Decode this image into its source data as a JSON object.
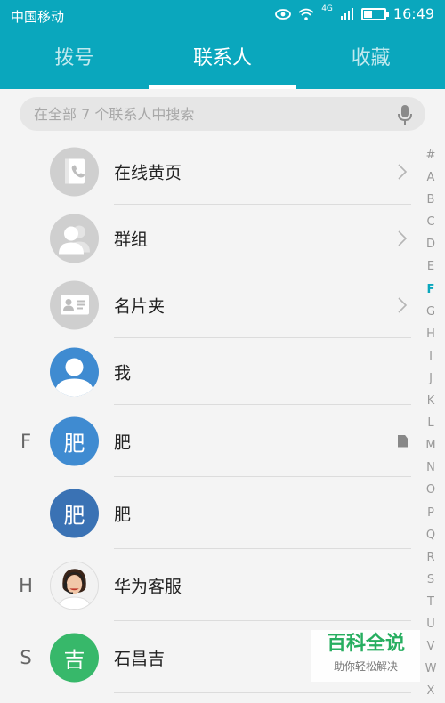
{
  "status": {
    "carrier": "中国移动",
    "net": "4G",
    "time": "16:49"
  },
  "tabs": [
    {
      "label": "拨号",
      "active": false
    },
    {
      "label": "联系人",
      "active": true
    },
    {
      "label": "收藏",
      "active": false
    }
  ],
  "search": {
    "placeholder": "在全部 7 个联系人中搜索"
  },
  "contacts": [
    {
      "letter": "",
      "name": "在线黄页",
      "avatar": "yellow-pages-icon",
      "chevron": true
    },
    {
      "letter": "",
      "name": "群组",
      "avatar": "group-icon",
      "chevron": true
    },
    {
      "letter": "",
      "name": "名片夹",
      "avatar": "business-card-icon",
      "chevron": true
    },
    {
      "letter": "",
      "name": "我",
      "avatar": "me-avatar-icon"
    },
    {
      "letter": "F",
      "name": "肥",
      "avatar_text": "肥",
      "avatar_color": "#3f8bd1",
      "sim": true
    },
    {
      "letter": "",
      "name": "肥",
      "avatar_text": "肥",
      "avatar_color": "#3a72b4"
    },
    {
      "letter": "H",
      "name": "华为客服",
      "avatar": "service-agent-photo"
    },
    {
      "letter": "S",
      "name": "石昌吉",
      "avatar_text": "吉",
      "avatar_color": "#37b86a"
    }
  ],
  "index_letters": [
    "#",
    "A",
    "B",
    "C",
    "D",
    "E",
    "F",
    "G",
    "H",
    "I",
    "J",
    "K",
    "L",
    "M",
    "N",
    "O",
    "P",
    "Q",
    "R",
    "S",
    "T",
    "U",
    "V",
    "W",
    "X"
  ],
  "index_active": "F",
  "watermark": {
    "line1": "百科全说",
    "line2": "助你轻松解决"
  },
  "colors": {
    "accent": "#0aa7bd"
  }
}
